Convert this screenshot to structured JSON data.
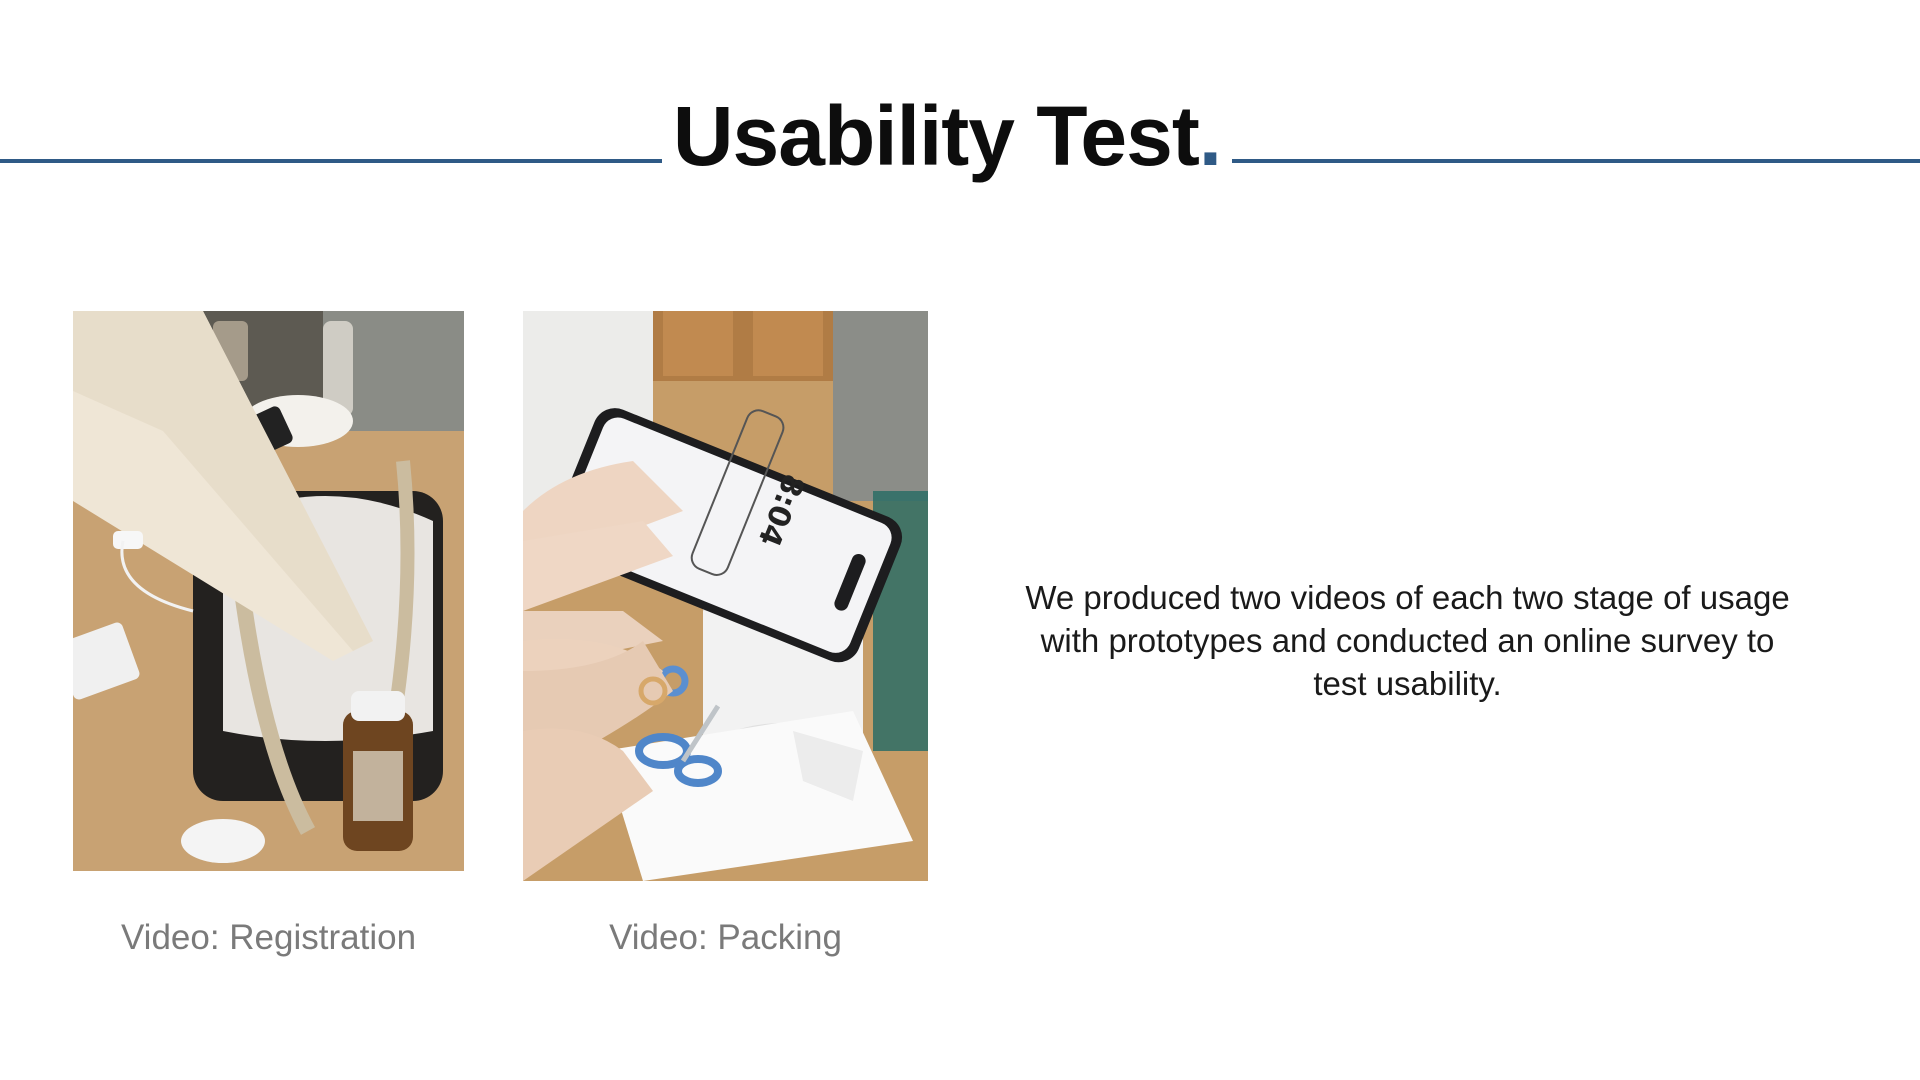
{
  "slide": {
    "title_text": "Usability Test",
    "title_dot": ".",
    "body": "We produced two videos of each two stage of usage with prototypes and conducted an online survey to test usability.",
    "accent_color": "#2f5a86"
  },
  "media": [
    {
      "caption": "Video: Registration"
    },
    {
      "caption": "Video: Packing",
      "phone_time": "8:04"
    }
  ]
}
